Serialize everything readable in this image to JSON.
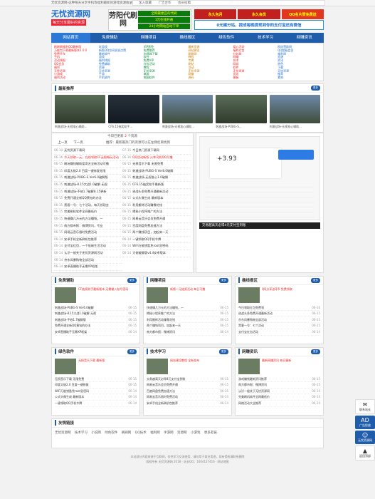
{
  "topbar": {
    "left": "无忧资源网-这种每天分享手机等福利最新的游戏资源收录",
    "links": [
      "加入收藏",
      "广告合作",
      "会员投稿"
    ]
  },
  "logo": {
    "title": "无忧资源网",
    "slogan": "每天分享最好的资源"
  },
  "banner_a": {
    "big": "劳阳代刷网",
    "lines": [
      "全网最便宜的代刷",
      "1元在线开通",
      "24小时网站自动下单"
    ]
  },
  "banner_b": {
    "row1": [
      "永久包月",
      "永久会员",
      "QQ名片赞免费送"
    ],
    "row2": "0元建分站，提成每晚提现到你的支付宝还有微信"
  },
  "nav": [
    "网站首页",
    "免费辅助",
    "网赚项目",
    "撸线报区",
    "绿色软件",
    "技术学习",
    "网赚资讯"
  ],
  "linkgrid": [
    [
      "刷刷刷福利QQ最新版",
      "玩游戏",
      "VIP直免",
      "最新资源",
      "爱心活动",
      "网站赞助网"
    ],
    [
      "万能包下载最新版本1.0.0",
      "新版QQ空间说说点赞",
      "免费推荐",
      "网站建设",
      "福利红包",
      "QQ超级会员"
    ],
    [
      "免费开车",
      "最新软件",
      "加速器下载",
      "刷刷网",
      "红包群",
      "福利网"
    ],
    [
      "手机",
      "游戏",
      "软件",
      "教程",
      "网赚",
      "资源"
    ],
    [
      "活动线报",
      "福利线报",
      "免费VIP",
      "专属",
      "技术",
      "资讯"
    ],
    [
      "QQ会员",
      "免费辅助",
      "红包活动",
      "刷钻",
      "网游",
      "特色"
    ],
    [
      "福利",
      "资源",
      "教程",
      "活动",
      "软件",
      "下载"
    ],
    [
      "无忧资源",
      "无忧资源",
      "无忧资源",
      "无忧资源",
      "无忧资源",
      "无忧资源"
    ],
    [
      "小游戏",
      "手游",
      "端游",
      "网赚",
      "资讯",
      "推荐"
    ],
    [
      "福利活动",
      "手机软件",
      "电脑软件",
      "源码",
      "模板",
      "素材"
    ]
  ],
  "latest": {
    "title": "最新推荐",
    "more": "更多",
    "items": [
      "刺激战场-无视准心辅助...",
      "CF6.15抽奖助手...",
      "刺激战场-无视准心辅助...",
      "刺激战场-PUBG-S...",
      "刺激战场-无视准心辅助..."
    ]
  },
  "today": {
    "prefix": "今日已更新",
    "count": "2",
    "suffix": "个资源"
  },
  "tabs": {
    "prev": "上一页",
    "next": "下一页",
    "tip": "推荐：最新最热门的资源可以在左侧栏目找到"
  },
  "list_left": [
    {
      "d": "06-10",
      "t": "无忧资源下载网"
    },
    {
      "d": "06-16",
      "t": "今天领取一元，在线领取CF无限畅玩活动",
      "r": true
    },
    {
      "d": "06-15",
      "t": "刷玩赚钱辅助爱奇艺全新活动可撸"
    },
    {
      "d": "06-15",
      "t": "印度太极2.0 百度一键修复无限"
    },
    {
      "d": "06-15",
      "t": "刺激战场-PUBG-S Ver6.0破解版"
    },
    {
      "d": "06-15",
      "t": "刺激战场-8.15大战1.0破解 无视"
    },
    {
      "d": "06-15",
      "t": "刺激战场-不修1.7破解8.15更新"
    },
    {
      "d": "06-15",
      "t": "免费开通全新QQ黄钻的办法"
    },
    {
      "d": "06-15",
      "t": "黑客一号：七个活动，每天领现金"
    },
    {
      "d": "06-15",
      "t": "完美刷机软件全网最低价"
    },
    {
      "d": "06-15",
      "t": "快速赚几万元的方法赚钱，一"
    },
    {
      "d": "06-15",
      "t": "南方都市报：微博资讯，专业"
    },
    {
      "d": "06-15",
      "t": "网易云音乐限时免费活动"
    },
    {
      "d": "06-14",
      "t": "安卓手机全新刷机包推荐"
    },
    {
      "d": "06-14",
      "t": "支付宝红包，一个低碳生活活动"
    },
    {
      "d": "06-14",
      "t": "认识一般关于无忧资源网活动"
    },
    {
      "d": "06-14",
      "t": "京东风暴购物全部活动"
    },
    {
      "d": "06-14",
      "t": "安卓直播助手无需XP框架"
    }
  ],
  "list_mid": [
    {
      "d": "07-15",
      "t": "今日热门资源下载网"
    },
    {
      "d": "06-16",
      "t": "QQ活动新版 火车司机QQ可撸",
      "r": true
    },
    {
      "d": "06-15",
      "t": "无损音乐下载 无限免费"
    },
    {
      "d": "06-15",
      "t": "刺激战场-PUBG-S Ver8.0破解"
    },
    {
      "d": "06-15",
      "t": "刺激战场-无视准心1.0破解"
    },
    {
      "d": "06-15",
      "t": "CF6.15抽奖助手最新版"
    },
    {
      "d": "06-15",
      "t": "逆战头条免费开通最新活动"
    },
    {
      "d": "06-15",
      "t": "公式头像生成 最新版本"
    },
    {
      "d": "06-15",
      "t": "利用搬砖活动赚零花钱"
    },
    {
      "d": "06-15",
      "t": "揭秘小程序推广的方法"
    },
    {
      "d": "06-15",
      "t": "网易云音乐会员免费开通"
    },
    {
      "d": "06-15",
      "t": "百度网盘免费加速方法"
    },
    {
      "d": "06-15",
      "t": "两个赚钱项目，加起来一天"
    },
    {
      "d": "06-14",
      "t": "一键领取QQ手机令牌"
    },
    {
      "d": "06-14",
      "t": "WiFi万能钥匙免root显密码"
    },
    {
      "d": "06-14",
      "t": "大佬破解版v4.4安卓版本"
    }
  ],
  "screen": {
    "value": "+3.93",
    "caption": "交易越高天必得4元支付宝到账"
  },
  "sec1": {
    "title": "免费辅助",
    "more": "更多",
    "headline": "CF抽奖助手最新版本 无需输入账号密码",
    "items": [
      [
        "刺激战场-PUBG-S Ver6.0破解",
        "06-15"
      ],
      [
        "刺激战场-8.15大战1.0破解 无视",
        "06-15"
      ],
      [
        "刺激战场-不修1.7破解版",
        "06-15"
      ],
      [
        "免费开通全新QQ黄钻的办法",
        "06-15"
      ],
      [
        "安卓直播助手无需XP框架",
        "06-14"
      ]
    ]
  },
  "sec2": {
    "title": "网赚项目",
    "more": "更多",
    "headline": "新版一元抽奖活动 每日可撸",
    "items": [
      [
        "快速赚几万元的方法赚钱，一",
        "06-15"
      ],
      [
        "揭秘小程序推广的方法",
        "06-15"
      ],
      [
        "利用搬砖活动赚零花钱",
        "06-15"
      ],
      [
        "两个赚钱项目，加起来一天",
        "06-15"
      ],
      [
        "南方都市报：微博资讯",
        "06-14"
      ]
    ]
  },
  "sec3": {
    "title": "撸线报区",
    "more": "更多",
    "headline": "QQ分享送Q币 免费领取",
    "items": [
      [
        "今日领取红包免费领",
        "06-16"
      ],
      [
        "逆战头条免费开通最新活动",
        "06-15"
      ],
      [
        "京东风暴购物全部活动",
        "06-15"
      ],
      [
        "黑客一号：七个活动",
        "06-15"
      ],
      [
        "支付宝红包活动",
        "06-14"
      ]
    ]
  },
  "sec4": {
    "title": "绿色软件",
    "more": "更多",
    "headline": "无损音乐下载 最新版",
    "items": [
      [
        "无损音乐下载 无限免费",
        "06-15"
      ],
      [
        "印度太极2.0 百度一键修复",
        "06-15"
      ],
      [
        "WiFi万能钥匙免root显密码",
        "06-14"
      ],
      [
        "公式头像生成 最新版本",
        "06-14"
      ],
      [
        "一键领取QQ手机令牌",
        "06-14"
      ]
    ]
  },
  "sec5": {
    "title": "技术学习",
    "more": "更多",
    "headline": "网站建设教程 全新发布",
    "items": [
      [
        "交易越高天必得4元支付宝到账",
        "06-15"
      ],
      [
        "网易云音乐会员免费开通",
        "06-15"
      ],
      [
        "百度网盘免费加速方法",
        "06-15"
      ],
      [
        "网易云音乐限时免费活动",
        "06-14"
      ],
      [
        "安卓手机全新刷机包推荐",
        "06-14"
      ]
    ]
  },
  "sec6": {
    "title": "网赚资讯",
    "more": "更多",
    "headline": "最新网赚资讯 每日更新",
    "items": [
      [
        "游戏赚钱最新资讯推荐",
        "06-15"
      ],
      [
        "南方都市报：微博资讯",
        "06-15"
      ],
      [
        "认识一般关于无忧资源网",
        "06-14"
      ],
      [
        "完美刷机软件全网最低价",
        "06-14"
      ],
      [
        "网络活动大全推荐",
        "06-14"
      ]
    ]
  },
  "friends": {
    "title": "友情链接",
    "links": "无忧资源网 技术学习 小说网 绿色软件 刷刷网 QQ技术 福利网 手游网 资源网 小游戏 更多友链"
  },
  "footer": {
    "line1": "本站部分内容来源于互联网，仅供学习交流使用，请勿用于商业用途，如有侵权请联系删除",
    "line2": "版权所有 无忧资源网 2018 · 站长QQ：1604127416 · 网站地图"
  },
  "side": {
    "a": "联系站长",
    "b": "广告投放",
    "c": "无忧资源网",
    "d": "返回顶部"
  }
}
